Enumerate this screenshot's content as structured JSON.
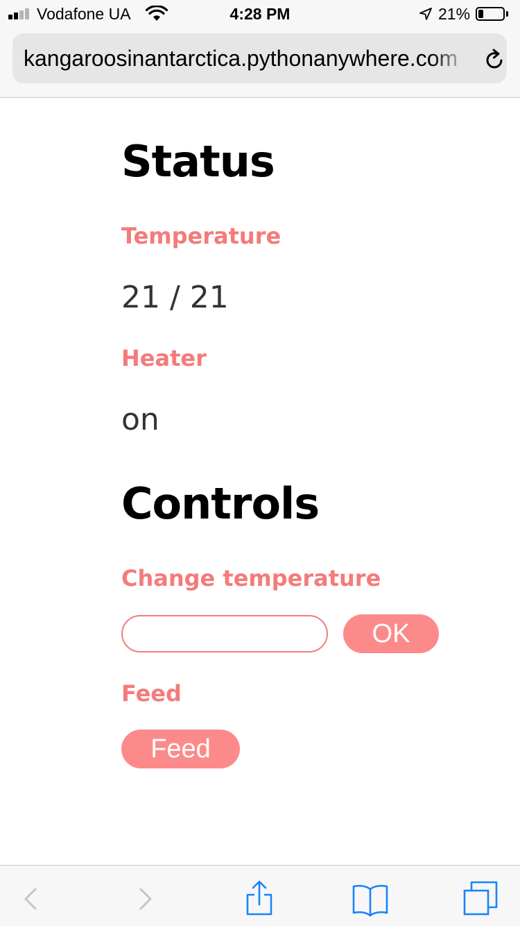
{
  "status_bar": {
    "carrier": "Vodafone UA",
    "time": "4:28 PM",
    "battery_percent": "21%",
    "battery_level": 0.21,
    "signal_bars": 2,
    "icons": [
      "signal-icon",
      "wifi-icon",
      "location-arrow-icon",
      "battery-icon"
    ]
  },
  "browser": {
    "url": "kangaroosinantarctica.pythonanywhere.com",
    "icons": [
      "reload-icon"
    ]
  },
  "page": {
    "status_heading": "Status",
    "temperature_label": "Temperature",
    "temperature_value": "21 / 21",
    "heater_label": "Heater",
    "heater_value": "on",
    "controls_heading": "Controls",
    "change_temp_label": "Change temperature",
    "temp_input_value": "",
    "ok_button": "OK",
    "feed_label": "Feed",
    "feed_button": "Feed"
  },
  "colors": {
    "accent": "#f47b7b",
    "button": "#fd8a8a",
    "ios_blue": "#1a82fb",
    "disabled": "#c4c4c4"
  },
  "toolbar": {
    "icons": [
      "back-icon",
      "forward-icon",
      "share-icon",
      "bookmarks-icon",
      "tabs-icon"
    ]
  }
}
